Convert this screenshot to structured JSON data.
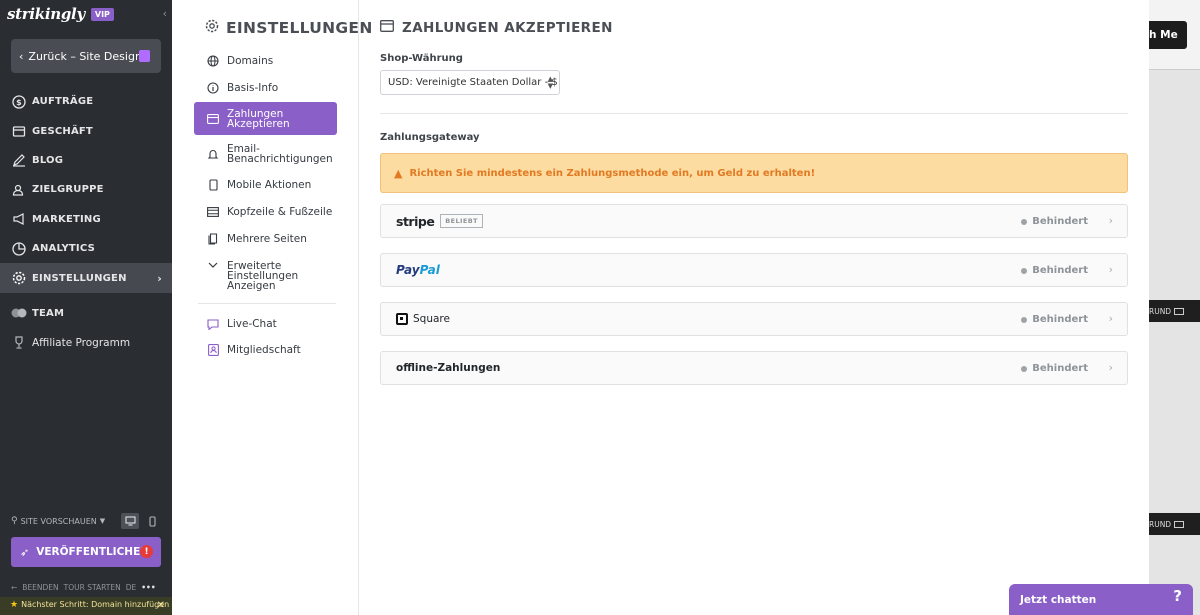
{
  "app": {
    "logo": "strikingly",
    "vip_badge": "VIP"
  },
  "left_sidebar": {
    "back_button": "Zurück – Site Design",
    "items": [
      {
        "label": "AUFTRÄGE",
        "icon": "dollar-icon"
      },
      {
        "label": "GESCHÄFT",
        "icon": "store-icon"
      },
      {
        "label": "BLOG",
        "icon": "pen-icon"
      },
      {
        "label": "ZIELGRUPPE",
        "icon": "users-icon"
      },
      {
        "label": "MARKETING",
        "icon": "megaphone-icon"
      },
      {
        "label": "ANALYTICS",
        "icon": "chart-icon"
      },
      {
        "label": "EINSTELLUNGEN",
        "icon": "gear-icon",
        "active": true
      },
      {
        "label": "TEAM",
        "icon": "team-icon"
      },
      {
        "label": "Affiliate Programm",
        "icon": "trophy-icon"
      }
    ],
    "preview_label": "SITE VORSCHAUEN",
    "publish_label": "VERÖFFENTLICHEN",
    "publish_alert": "!",
    "tour": {
      "end": "BEENDEN",
      "start": "TOUR STARTEN",
      "lang": "DE",
      "more": "•••"
    },
    "next_step": "Nächster Schritt: Domain hinzufügen"
  },
  "settings_menu": {
    "title": "EINSTELLUNGEN",
    "items": [
      {
        "label": "Domains",
        "icon": "globe-icon"
      },
      {
        "label": "Basis-Info",
        "icon": "info-icon"
      },
      {
        "label": "Zahlungen Akzeptieren",
        "icon": "card-icon",
        "active": true
      },
      {
        "label": "Email-Benachrichtigungen",
        "icon": "bell-icon"
      },
      {
        "label": "Mobile Aktionen",
        "icon": "mobile-icon"
      },
      {
        "label": "Kopfzeile & Fußzeile",
        "icon": "layout-icon"
      },
      {
        "label": "Mehrere Seiten",
        "icon": "pages-icon"
      },
      {
        "label": "Erweiterte Einstellungen Anzeigen",
        "icon": "chevron-down-icon"
      },
      {
        "label": "Live-Chat",
        "icon": "chat-icon"
      },
      {
        "label": "Mitgliedschaft",
        "icon": "member-icon"
      }
    ]
  },
  "payments": {
    "title": "ZAHLUNGEN AKZEPTIEREN",
    "currency_label": "Shop-Währung",
    "currency_value": "USD: Vereinigte Staaten Dollar - $",
    "gateway_label": "Zahlungsgateway",
    "warning": "Richten Sie mindestens ein Zahlungsmethode ein, um Geld zu erhalten!",
    "gateways": [
      {
        "name": "stripe",
        "badge": "BELIEBT",
        "status": "Behindert"
      },
      {
        "name": "PayPal",
        "status": "Behindert"
      },
      {
        "name": "Square",
        "status": "Behindert"
      },
      {
        "name": "offline-Zahlungen",
        "status": "Behindert"
      }
    ]
  },
  "site_preview": {
    "button_fragment": "h Me",
    "strip_label": "RUND"
  },
  "chat_widget": {
    "label": "Jetzt chatten",
    "help": "?"
  },
  "colors": {
    "accent": "#8a5fc8",
    "sidebar_bg": "#2a2d31",
    "warning_bg": "#fcdca0",
    "warning_text": "#e27a24"
  }
}
